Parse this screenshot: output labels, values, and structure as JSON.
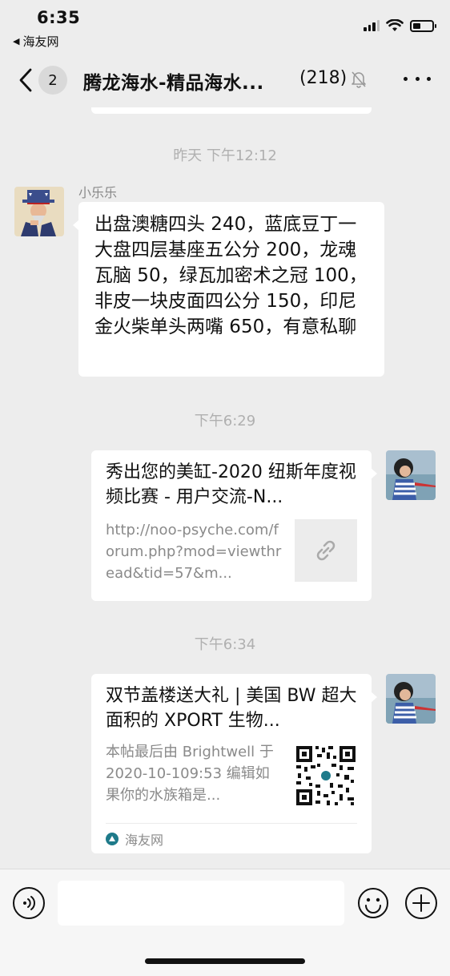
{
  "status_bar": {
    "time": "6:35",
    "back_app": "海友网"
  },
  "nav": {
    "unread_count": "2",
    "title": "腾龙海水-精品海水...",
    "member_count": "(218)"
  },
  "messages": [
    {
      "timestamp": "昨天 下午12:12",
      "sender": "小乐乐",
      "text": "出盘澳糖四头 240，蓝底豆丁一大盘四层基座五公分 200，龙魂瓦脑 50，绿瓦加密术之冠 100，非皮一块皮面四公分 150，印尼金火柴单头两嘴 650，有意私聊"
    },
    {
      "timestamp": "下午6:29",
      "link_title": "秀出您的美缸-2020 纽斯年度视频比赛 - 用户交流-N...",
      "link_desc": "http://noo-psyche.com/forum.php?mod=viewthread&tid=57&m..."
    },
    {
      "timestamp": "下午6:34",
      "link_title": "双节盖楼送大礼 | 美国 BW 超大面积的 XPORT 生物...",
      "link_desc": "本帖最后由 Brightwell 于 2020-10-109:53 编辑如果你的水族箱是...",
      "source": "海友网"
    }
  ],
  "colors": {
    "background": "#ededed",
    "bubble": "#ffffff",
    "timestamp": "#b0b0b0",
    "secondary_text": "#8a8a8a"
  }
}
